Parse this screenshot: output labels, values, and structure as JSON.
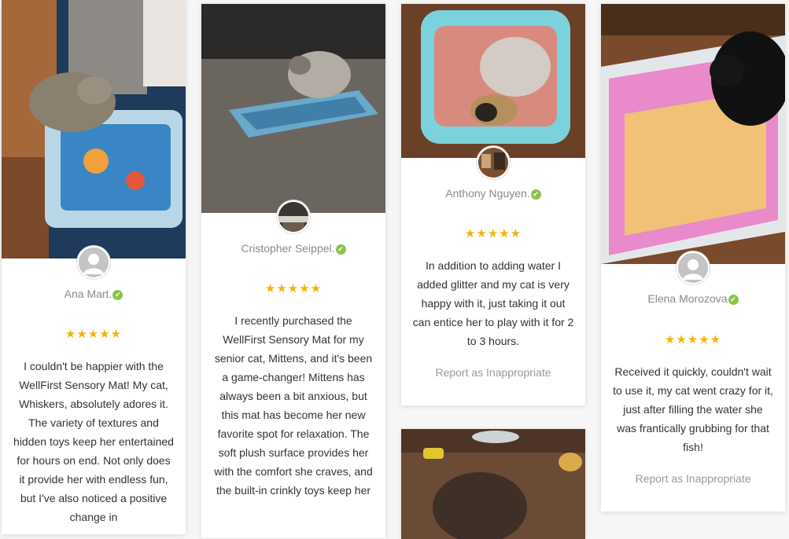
{
  "reviews": [
    {
      "name": "Ana Mart.",
      "rating": 5,
      "stars": "★★★★★",
      "text": "I couldn't be happier with the WellFirst Sensory Mat! My cat, Whiskers, absolutely adores it. The variety of textures and hidden toys keep her entertained for hours on end. Not only does it provide her with endless fun, but I've also noticed a positive change in"
    },
    {
      "name": "Cristopher Seippel.",
      "rating": 5,
      "stars": "★★★★★",
      "text": "I recently purchased the WellFirst Sensory Mat for my senior cat, Mittens, and it's been a game-changer! Mittens has always been a bit anxious, but this mat has become her new favorite spot for relaxation. The soft plush surface provides her with the comfort she craves, and the built-in crinkly toys keep her"
    },
    {
      "name": "Anthony Nguyen.",
      "rating": 5,
      "stars": "★★★★★",
      "text": "In addition to adding water I added glitter and my cat is very happy with it, just taking it out can entice her to play with it for 2 to 3 hours.",
      "report": "Report as Inappropriate"
    },
    {
      "name": "Elena Morozova",
      "rating": 5,
      "stars": "★★★★★",
      "text": "Received it quickly, couldn't wait to use it, my cat went crazy for it, just after filling the water she was frantically grubbing for that fish!",
      "report": "Report as Inappropriate"
    }
  ],
  "icons": {
    "verified": "✔",
    "avatar": "user-placeholder-icon"
  },
  "colors": {
    "star": "#f5b301",
    "verified": "#8bc34a",
    "name": "#8a8a8a",
    "report": "#9a9a9a"
  }
}
